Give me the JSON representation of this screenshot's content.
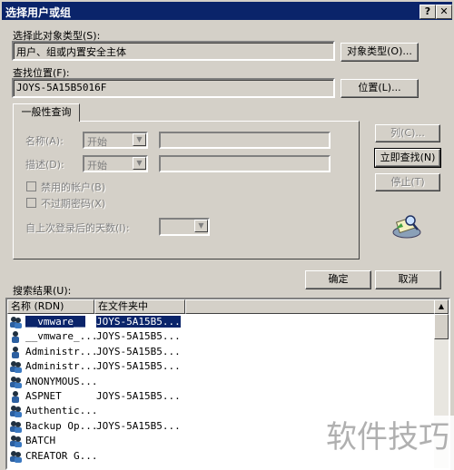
{
  "window": {
    "title": "选择用户或组",
    "help_label": "?",
    "close_label": "✕"
  },
  "object_type": {
    "label": "选择此对象类型(S):",
    "value": "用户、组或内置安全主体",
    "button": "对象类型(O)..."
  },
  "location": {
    "label": "查找位置(F):",
    "value": "JOYS-5A15B5016F",
    "button": "位置(L)..."
  },
  "query": {
    "tab_label": "一般性查询",
    "name_label": "名称(A):",
    "name_op": "开始",
    "desc_label": "描述(D):",
    "desc_op": "开始",
    "disabled_accounts": "禁用的帐户(B)",
    "non_expiring_pwd": "不过期密码(X)",
    "days_since_logon": "自上次登录后的天数(I):",
    "columns_button": "列(C)...",
    "find_now_button": "立即查找(N)",
    "stop_button": "停止(T)"
  },
  "ok_button": "确定",
  "cancel_button": "取消",
  "results": {
    "label": "搜索结果(U):",
    "columns": [
      "名称 (RDN)",
      "在文件夹中"
    ],
    "rows": [
      {
        "name": "__vmware__",
        "folder": "JOYS-5A15B5...",
        "icon": "group-icon",
        "selected": true
      },
      {
        "name": "__vmware_...",
        "folder": "JOYS-5A15B5...",
        "icon": "user-icon"
      },
      {
        "name": "Administr...",
        "folder": "JOYS-5A15B5...",
        "icon": "user-icon"
      },
      {
        "name": "Administr...",
        "folder": "JOYS-5A15B5...",
        "icon": "group-icon"
      },
      {
        "name": "ANONYMOUS...",
        "folder": "",
        "icon": "group-icon"
      },
      {
        "name": "ASPNET",
        "folder": "JOYS-5A15B5...",
        "icon": "user-icon"
      },
      {
        "name": "Authentic...",
        "folder": "",
        "icon": "group-icon"
      },
      {
        "name": "Backup Op...",
        "folder": "JOYS-5A15B5...",
        "icon": "group-icon"
      },
      {
        "name": "BATCH",
        "folder": "",
        "icon": "group-icon"
      },
      {
        "name": "CREATOR G...",
        "folder": "",
        "icon": "group-icon"
      }
    ]
  },
  "watermark": "软件技巧",
  "colors": {
    "title_bar": "#0a246a",
    "face": "#d4d0c8",
    "selection": "#0a246a"
  }
}
